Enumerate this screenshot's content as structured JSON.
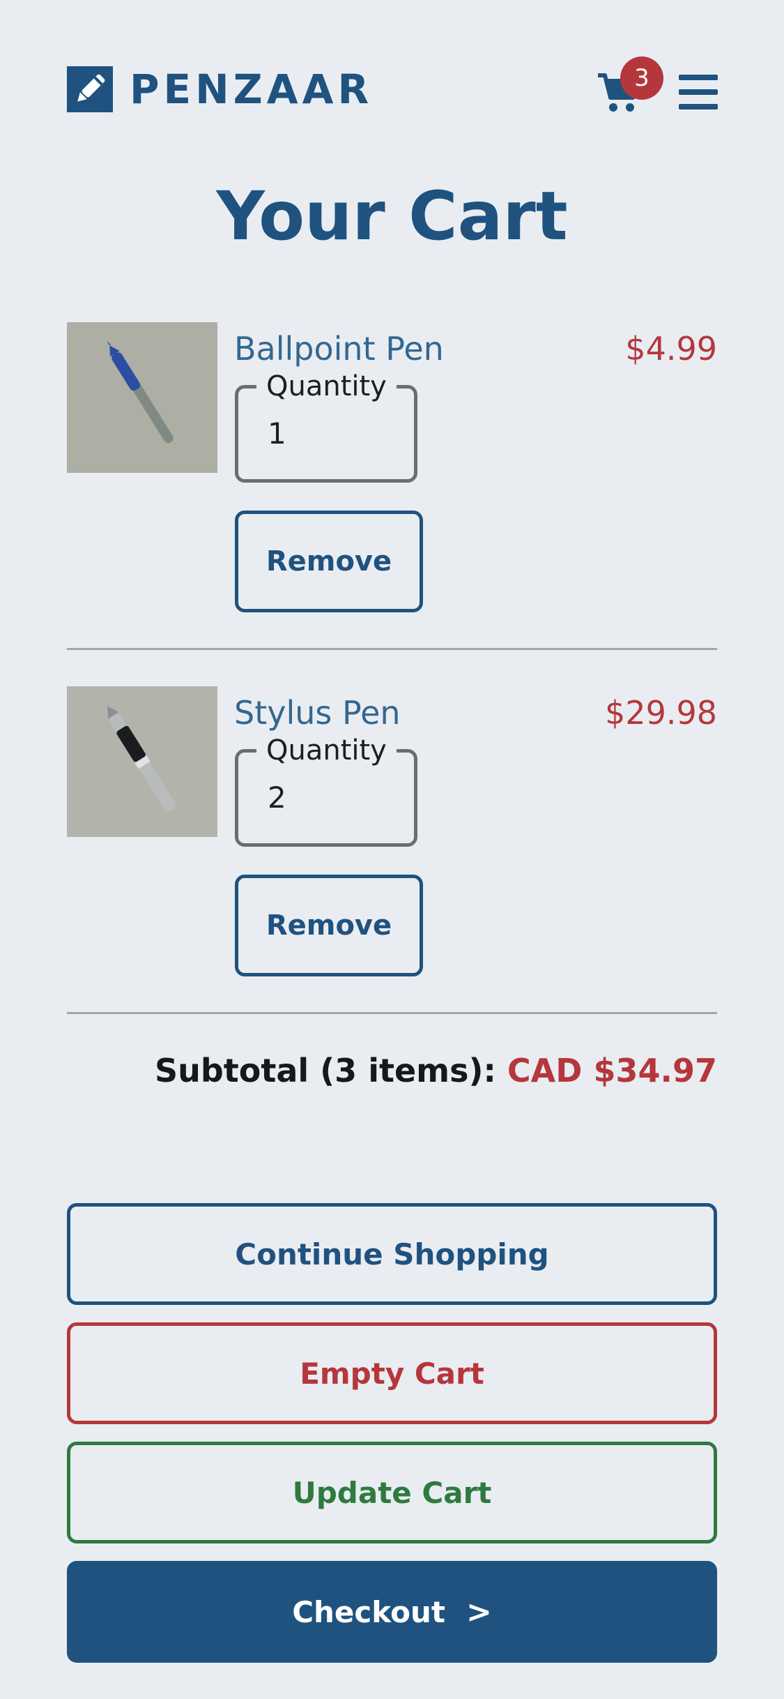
{
  "header": {
    "brand": "PENZAAR",
    "cart_count": "3"
  },
  "page": {
    "title": "Your Cart"
  },
  "items": [
    {
      "name": "Ballpoint Pen",
      "price": "$4.99",
      "quantity_label": "Quantity",
      "quantity": "1",
      "remove_label": "Remove"
    },
    {
      "name": "Stylus Pen",
      "price": "$29.98",
      "quantity_label": "Quantity",
      "quantity": "2",
      "remove_label": "Remove"
    }
  ],
  "summary": {
    "subtotal_label": "Subtotal (3 items):",
    "subtotal_value": "CAD $34.97"
  },
  "actions": {
    "continue_label": "Continue Shopping",
    "empty_label": "Empty Cart",
    "update_label": "Update Cart",
    "checkout_label": "Checkout",
    "checkout_chevron": ">"
  },
  "colors": {
    "brand": "#1f527f",
    "price": "#b5373b",
    "update": "#2f7a3f",
    "background": "#e9edf2"
  }
}
